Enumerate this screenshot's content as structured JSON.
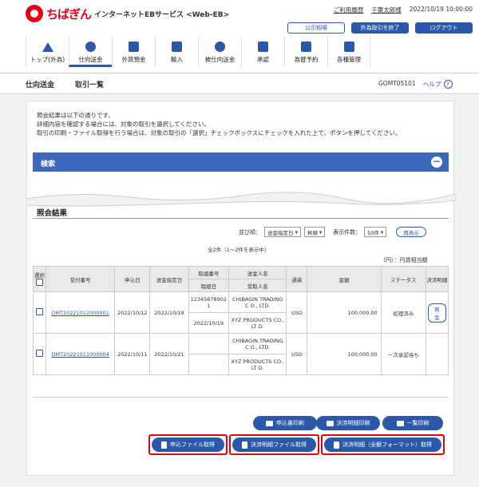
{
  "header": {
    "brand": "ちばぎん",
    "service": "インターネットEBサービス <Web-EB>",
    "links": [
      "ご利用履歴",
      "千葉太郎様",
      "2022/10/19 10:00:00"
    ],
    "buttons": {
      "public": "公示相場",
      "fx_end": "外為取引を終了",
      "logout": "ログアウト"
    }
  },
  "nav": [
    {
      "label": "トップ(外為)",
      "icon": "home-icon"
    },
    {
      "label": "仕向送金",
      "icon": "yen-icon"
    },
    {
      "label": "外貨預金",
      "icon": "deposit-icon"
    },
    {
      "label": "輸入",
      "icon": "import-icon"
    },
    {
      "label": "被仕向送金",
      "icon": "receive-icon"
    },
    {
      "label": "承認",
      "icon": "approve-icon"
    },
    {
      "label": "為替予約",
      "icon": "contract-icon"
    },
    {
      "label": "各種管理",
      "icon": "manage-icon"
    }
  ],
  "breadcrumb": {
    "section": "仕向送金",
    "page": "取引一覧",
    "code": "GOMT05101",
    "help": "ヘルプ"
  },
  "message": [
    "照会結果は以下の通りです。",
    "詳細内容を確認する場合には、対象の取引を選択してください。",
    "取引の印刷・ファイル取得を行う場合は、対象の取引の「選択」チェックボックスにチェックを入れた上で、ボタンを押してください。"
  ],
  "search": {
    "title": "検索"
  },
  "results": {
    "title": "照会結果",
    "sort_label": "並び順：",
    "sort_value": "送金指定日",
    "order_value": "昇順",
    "count_label": "表示件数：",
    "count_value": "50件",
    "redisplay": "再表示",
    "summary": "全2件（1～2件を表示中）",
    "unit": "（円）：円貨相当額"
  },
  "table": {
    "headers": {
      "select": "選択",
      "receipt": "受付番号",
      "apply_date": "申込日",
      "send_date": "送金指定日",
      "deal_no": "取組番号",
      "deal_date": "取組日",
      "remitter": "送金人名",
      "receiver": "受取人名",
      "currency": "通貨",
      "amount": "金額",
      "status": "ステータス",
      "detail": "決済明細"
    },
    "rows": [
      {
        "receipt": "OMT20221012000001",
        "apply_date": "2022/10/12",
        "send_date": "2022/10/19",
        "deal_no": "12345678902 1",
        "deal_date": "2022/10/19",
        "remitter": "CHIBAGIN TRADING C O., LTD.",
        "receiver": "XYZ PRODUCTS CO., LT D.",
        "currency": "USD",
        "amount": "100,000.00",
        "status": "処理済み",
        "detail": "照会"
      },
      {
        "receipt": "OMT20221011000004",
        "apply_date": "2022/10/11",
        "send_date": "2022/10/21",
        "deal_no": "",
        "deal_date": "",
        "remitter": "CHIBAGIN TRADING C O., LTD.",
        "receiver": "XYZ PRODUCTS CO., LT D.",
        "currency": "USD",
        "amount": "100,000.00",
        "status": "一次承認待ち",
        "detail": ""
      }
    ]
  },
  "actions": {
    "print_app": "申込書印刷",
    "print_stmt": "決済明細印刷",
    "print_list": "一覧印刷",
    "file_app": "申込ファイル取得",
    "file_stmt": "決済明細ファイル取得",
    "file_stmt_full": "決済明細（全銀フォーマット）取得"
  },
  "colors": {
    "primary": "#2b58a8",
    "brand_red": "#e60012"
  }
}
